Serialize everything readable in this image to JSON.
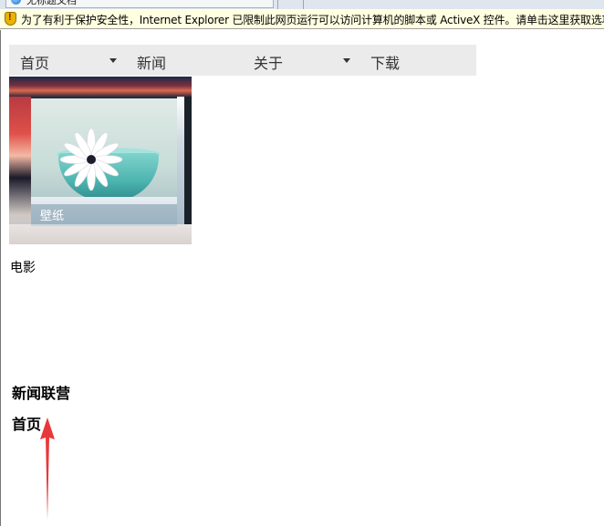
{
  "browser": {
    "tab_title": "无标题文档",
    "infobar_message": "为了有利于保护安全性，Internet Explorer 已限制此网页运行可以访问计算机的脚本或 ActiveX 控件。请单击这里获取选项..."
  },
  "nav": {
    "items": [
      {
        "label": "首页",
        "has_dropdown": true
      },
      {
        "label": "新闻",
        "has_dropdown": false
      },
      {
        "label": "关于",
        "has_dropdown": true
      },
      {
        "label": "下载",
        "has_dropdown": false
      }
    ]
  },
  "thumbnail": {
    "caption": "壁纸"
  },
  "content": {
    "movie_label": "电影",
    "news_heading": "新闻联营",
    "home_heading": "首页"
  },
  "annotation": {
    "arrow_color": "#e8383a"
  },
  "colors": {
    "navbar_bg": "#ebebeb",
    "infobar_bg": "#ffffe1"
  }
}
